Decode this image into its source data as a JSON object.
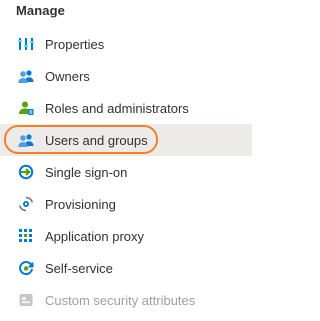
{
  "section": {
    "heading": "Manage"
  },
  "menu": {
    "items": [
      {
        "label": "Properties",
        "icon": "properties-icon"
      },
      {
        "label": "Owners",
        "icon": "owners-icon"
      },
      {
        "label": "Roles and administrators",
        "icon": "roles-icon"
      },
      {
        "label": "Users and groups",
        "icon": "users-groups-icon",
        "selected": true
      },
      {
        "label": "Single sign-on",
        "icon": "sso-icon"
      },
      {
        "label": "Provisioning",
        "icon": "provisioning-icon"
      },
      {
        "label": "Application proxy",
        "icon": "app-proxy-icon"
      },
      {
        "label": "Self-service",
        "icon": "self-service-icon"
      },
      {
        "label": "Custom security attributes",
        "icon": "custom-attributes-icon",
        "disabled": true
      }
    ]
  },
  "colors": {
    "highlight": "#f47f2a",
    "selected_bg": "#edebe9",
    "text": "#323130",
    "disabled_text": "#a19f9d",
    "azure_blue": "#0078d4",
    "green": "#57a300"
  }
}
